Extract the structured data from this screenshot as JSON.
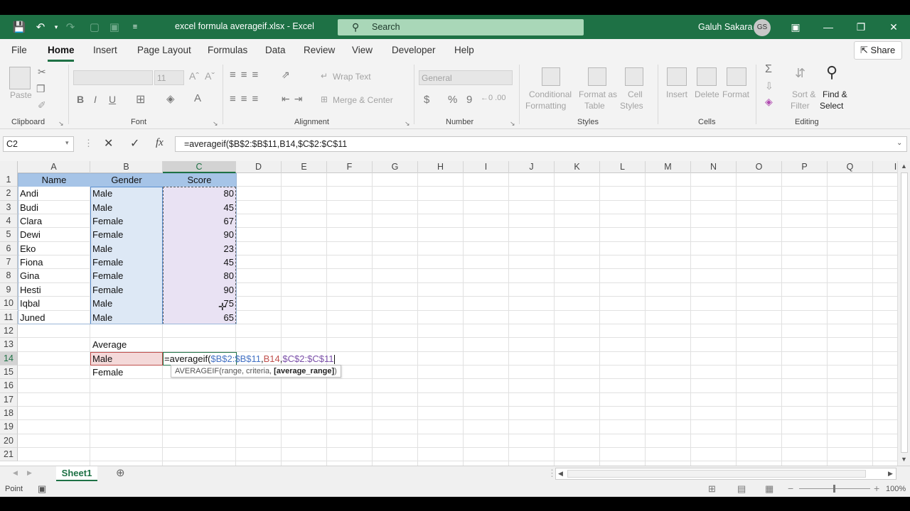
{
  "titlebar": {
    "document_title": "excel formula averageif.xlsx  -  Excel",
    "search_label": "Search",
    "user_name": "Galuh Sakara",
    "user_initials": "GS"
  },
  "menu": {
    "tabs": [
      "File",
      "Home",
      "Insert",
      "Page Layout",
      "Formulas",
      "Data",
      "Review",
      "View",
      "Developer",
      "Help"
    ],
    "share_label": "Share"
  },
  "ribbon": {
    "clipboard": {
      "paste_label": "Paste",
      "group_label": "Clipboard"
    },
    "font": {
      "font_name": "",
      "font_size": "11",
      "group_label": "Font",
      "bold": "B",
      "italic": "I",
      "underline": "U"
    },
    "alignment": {
      "wrap_text": "Wrap Text",
      "merge_center": "Merge & Center",
      "group_label": "Alignment"
    },
    "number": {
      "format": "General",
      "currency": "$",
      "percent": "%",
      "comma": "9",
      "group_label": "Number"
    },
    "styles": {
      "conditional_1": "Conditional",
      "conditional_2": "Formatting",
      "format_as_1": "Format as",
      "format_as_2": "Table",
      "cell_styles_1": "Cell",
      "cell_styles_2": "Styles",
      "group_label": "Styles"
    },
    "cells": {
      "insert": "Insert",
      "delete": "Delete",
      "format": "Format",
      "group_label": "Cells"
    },
    "editing": {
      "sort_1": "Sort &",
      "sort_2": "Filter",
      "find_1": "Find &",
      "find_2": "Select",
      "group_label": "Editing"
    }
  },
  "formula_bar": {
    "name_box": "C2",
    "fx": "fx",
    "formula": "=averageif($B$2:$B$11,B14,$C$2:$C$11"
  },
  "grid": {
    "columns": [
      "A",
      "B",
      "C",
      "D",
      "E",
      "F",
      "G",
      "H",
      "I",
      "J",
      "K",
      "L",
      "M",
      "N",
      "O",
      "P",
      "Q",
      "I"
    ],
    "rows": [
      "1",
      "2",
      "3",
      "4",
      "5",
      "6",
      "7",
      "8",
      "9",
      "10",
      "11",
      "12",
      "13",
      "14",
      "15",
      "16",
      "17",
      "18",
      "19",
      "20",
      "21"
    ],
    "headers": {
      "name": "Name",
      "gender": "Gender",
      "score": "Score"
    },
    "data": [
      {
        "name": "Andi",
        "gender": "Male",
        "score": "80"
      },
      {
        "name": "Budi",
        "gender": "Male",
        "score": "45"
      },
      {
        "name": "Clara",
        "gender": "Female",
        "score": "67"
      },
      {
        "name": "Dewi",
        "gender": "Female",
        "score": "90"
      },
      {
        "name": "Eko",
        "gender": "Male",
        "score": "23"
      },
      {
        "name": "Fiona",
        "gender": "Female",
        "score": "45"
      },
      {
        "name": "Gina",
        "gender": "Female",
        "score": "80"
      },
      {
        "name": "Hesti",
        "gender": "Female",
        "score": "90"
      },
      {
        "name": "Iqbal",
        "gender": "Male",
        "score": "75"
      },
      {
        "name": "Juned",
        "gender": "Male",
        "score": "65"
      }
    ],
    "average_label": "Average",
    "male_label": "Male",
    "female_label": "Female",
    "editing_formula": {
      "prefix": "=averageif(",
      "range": "$B$2:$B$11",
      "sep1": ",",
      "criteria": "B14",
      "sep2": ",",
      "avg_range": "$C$2:$C$11"
    },
    "tooltip": {
      "text": "AVERAGEIF(range, criteria, ",
      "bold": "[average_range]",
      "close": ")"
    }
  },
  "sheets": {
    "active": "Sheet1"
  },
  "status": {
    "mode": "Point",
    "zoom": "100%"
  },
  "colors": {
    "excel_green": "#1e7145",
    "header_blue": "#a6c4e7",
    "range_blue": "#dde8f5",
    "range_purple": "#e9e2f3",
    "criteria_red": "#f4d9d9"
  }
}
